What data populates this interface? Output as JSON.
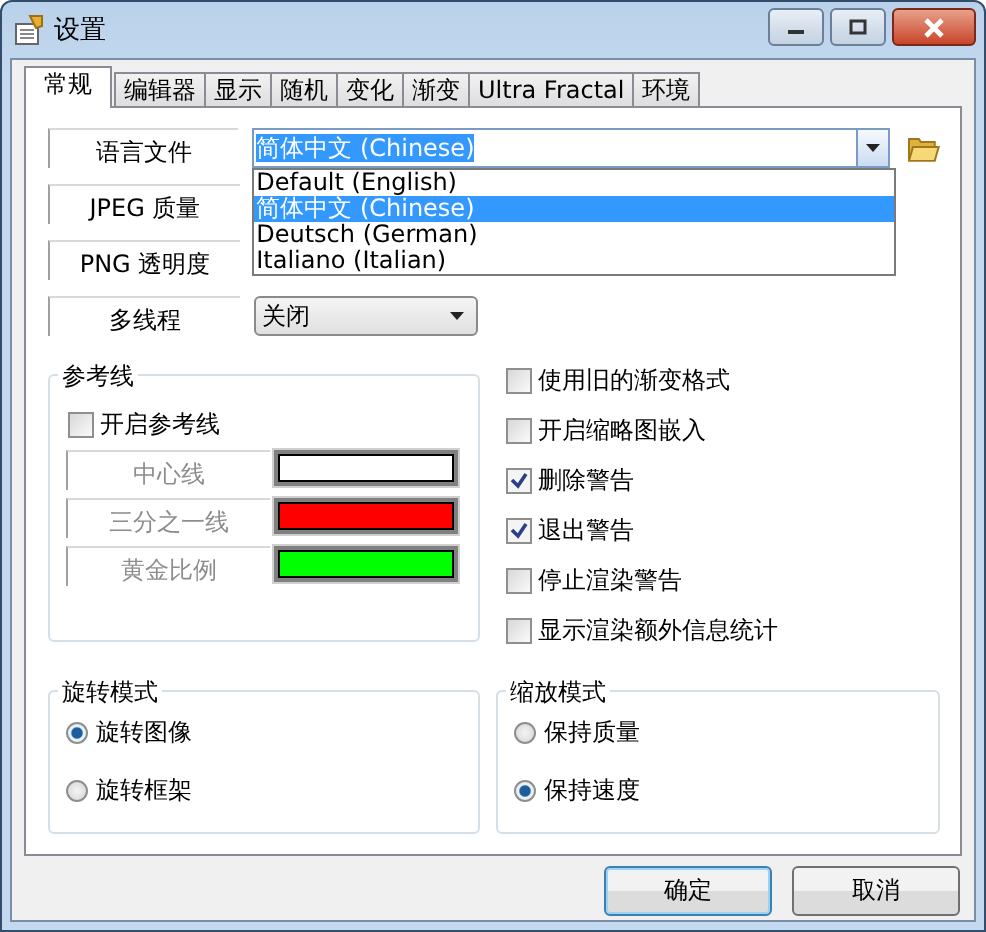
{
  "window": {
    "title": "设置"
  },
  "tabs": [
    {
      "label": "常规",
      "selected": true
    },
    {
      "label": "编辑器",
      "selected": false
    },
    {
      "label": "显示",
      "selected": false
    },
    {
      "label": "随机",
      "selected": false
    },
    {
      "label": "变化",
      "selected": false
    },
    {
      "label": "渐变",
      "selected": false
    },
    {
      "label": "Ultra Fractal",
      "selected": false
    },
    {
      "label": "环境",
      "selected": false
    }
  ],
  "language": {
    "label": "语言文件",
    "value": "简体中文 (Chinese)",
    "expanded": true,
    "options": [
      {
        "label": "Default (English)",
        "selected": false
      },
      {
        "label": "简体中文 (Chinese)",
        "selected": true
      },
      {
        "label": "Deutsch (German)",
        "selected": false
      },
      {
        "label": "Italiano (Italian)",
        "selected": false
      }
    ]
  },
  "jpeg_quality": {
    "label": "JPEG 质量"
  },
  "png_transparency": {
    "label": "PNG 透明度"
  },
  "multithread": {
    "label": "多线程",
    "value": "关闭"
  },
  "checkboxes": [
    {
      "label": "使用旧的渐变格式",
      "checked": false
    },
    {
      "label": "开启缩略图嵌入",
      "checked": false
    },
    {
      "label": "删除警告",
      "checked": true
    },
    {
      "label": "退出警告",
      "checked": true
    },
    {
      "label": "停止渲染警告",
      "checked": false
    },
    {
      "label": "显示渲染额外信息统计",
      "checked": false
    }
  ],
  "reference_lines": {
    "title": "参考线",
    "enable": {
      "label": "开启参考线",
      "checked": false
    },
    "disabled": true,
    "rows": [
      {
        "label": "中心线",
        "color": "#ffffff"
      },
      {
        "label": "三分之一线",
        "color": "#ff0000"
      },
      {
        "label": "黄金比例",
        "color": "#00ff00"
      }
    ]
  },
  "rotation_mode": {
    "title": "旋转模式",
    "options": [
      {
        "label": "旋转图像",
        "selected": true
      },
      {
        "label": "旋转框架",
        "selected": false
      }
    ]
  },
  "zoom_mode": {
    "title": "缩放模式",
    "options": [
      {
        "label": "保持质量",
        "selected": false
      },
      {
        "label": "保持速度",
        "selected": true
      }
    ]
  },
  "buttons": [
    {
      "label": "确定",
      "default": true
    },
    {
      "label": "取消",
      "default": false
    }
  ]
}
